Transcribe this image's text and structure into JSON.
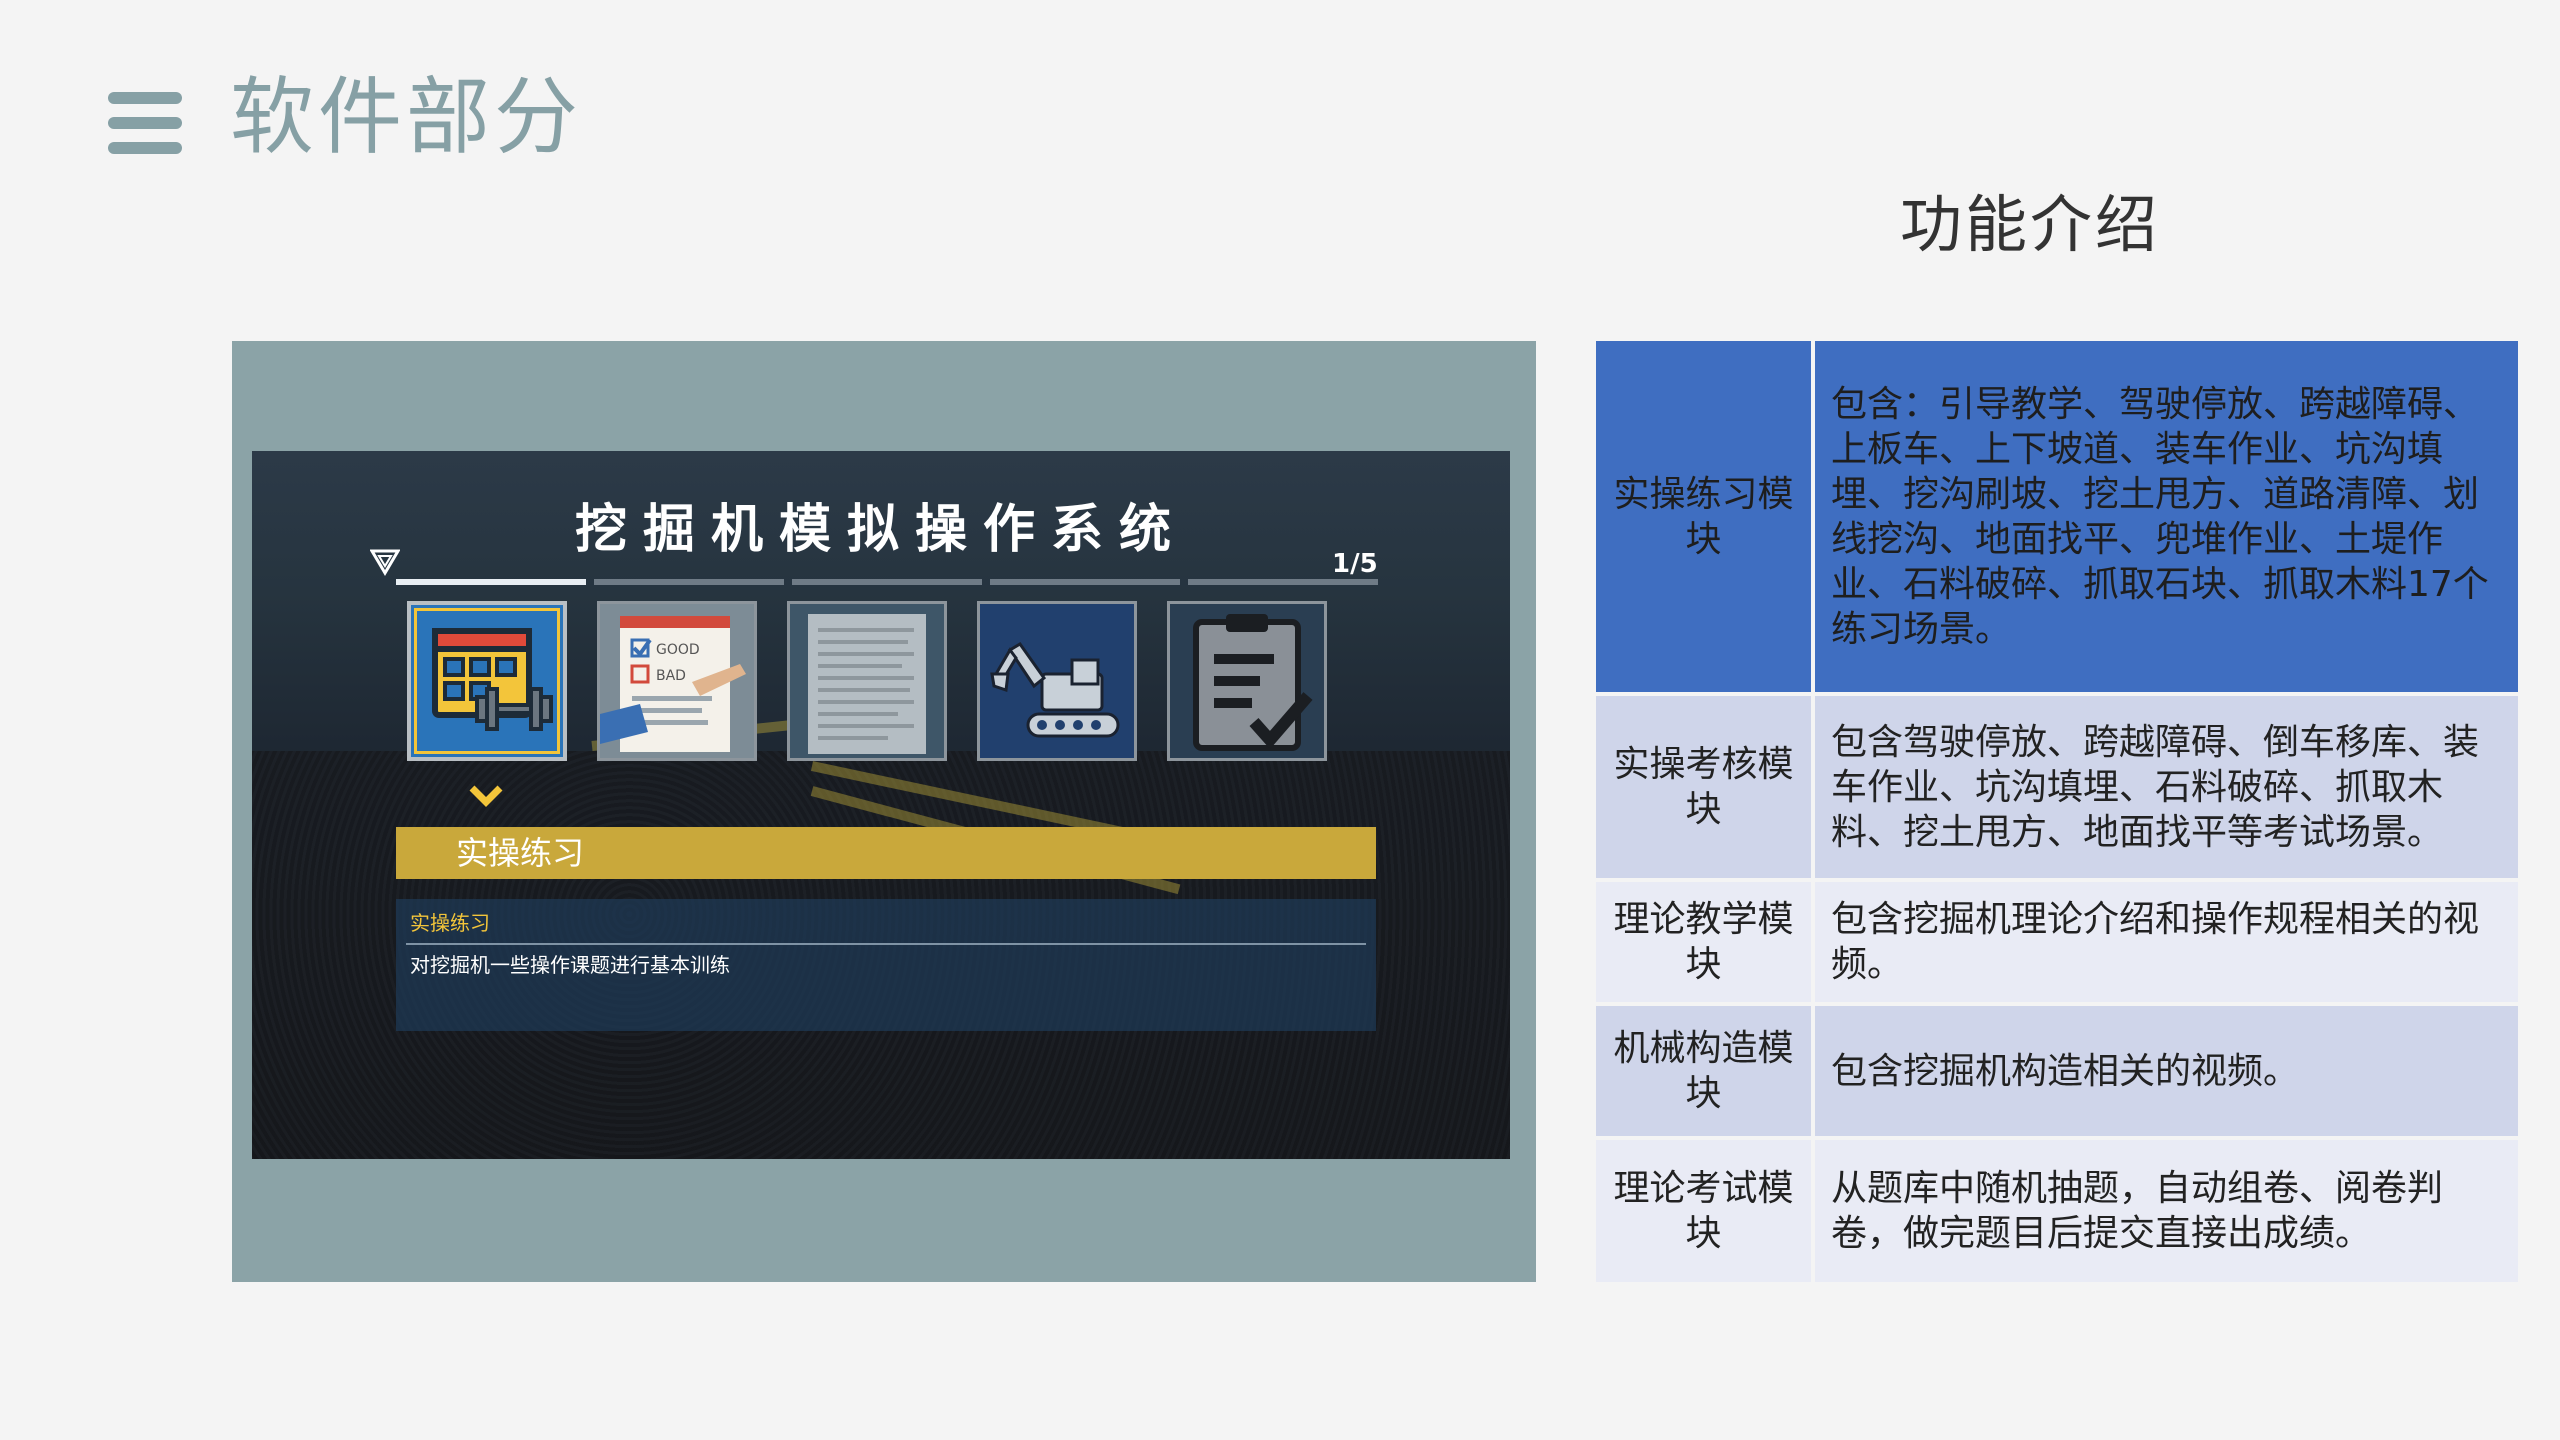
{
  "header": {
    "title": "软件部分",
    "menu_icon": "hamburger-menu-icon"
  },
  "section_title": "功能介绍",
  "screenshot": {
    "title": "挖掘机模拟操作系统",
    "page_indicator": "1/5",
    "cards": [
      {
        "name": "calendar-dumbbell-icon",
        "active": true
      },
      {
        "name": "checklist-good-bad-icon",
        "active": false,
        "good_label": "GOOD",
        "bad_label": "BAD"
      },
      {
        "name": "document-page-icon",
        "active": false
      },
      {
        "name": "excavator-icon",
        "active": false
      },
      {
        "name": "clipboard-check-icon",
        "active": false
      }
    ],
    "selected_mode": "实操练习",
    "description_title": "实操练习",
    "description_text": "对挖掘机一些操作课题进行基本训练",
    "accent_color": "#c9a83b",
    "highlight_color": "#f3c53a"
  },
  "table": {
    "rows": [
      {
        "module": "实操练习模块",
        "description": "包含：引导教学、驾驶停放、跨越障碍、上板车、上下坡道、装车作业、坑沟填埋、挖沟刷坡、挖土甩方、道路清障、划线挖沟、地面找平、兜堆作业、土堤作业、石料破碎、抓取石块、抓取木料17个练习场景。"
      },
      {
        "module": "实操考核模块",
        "description": "包含驾驶停放、跨越障碍、倒车移库、装车作业、坑沟填埋、石料破碎、抓取木料、挖土甩方、地面找平等考试场景。"
      },
      {
        "module": "理论教学模块",
        "description": "包含挖掘机理论介绍和操作规程相关的视频。"
      },
      {
        "module": "机械构造模块",
        "description": "包含挖掘机构造相关的视频。"
      },
      {
        "module": "理论考试模块",
        "description": "从题库中随机抽题，自动组卷、阅卷判卷，做完题目后提交直接出成绩。"
      }
    ],
    "colors": {
      "highlight_row": "#3f6ec1",
      "light_row": "#e9ebf5",
      "mid_row": "#cfd5ea"
    }
  }
}
